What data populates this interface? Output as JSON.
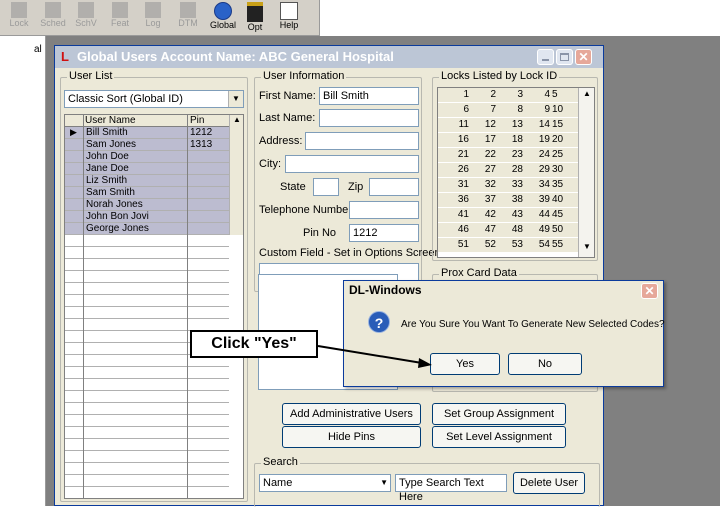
{
  "toolbar": {
    "buttons": [
      {
        "label": "Lock",
        "icon": "lock-icon",
        "enabled": false
      },
      {
        "label": "Sched",
        "icon": "schedule-icon",
        "enabled": false
      },
      {
        "label": "SchV",
        "icon": "schedule-view-icon",
        "enabled": false
      },
      {
        "label": "Feat",
        "icon": "feature-icon",
        "enabled": false
      },
      {
        "label": "Log",
        "icon": "log-icon",
        "enabled": false
      },
      {
        "label": "DTM",
        "icon": "dtm-icon",
        "enabled": false
      },
      {
        "label": "Global",
        "icon": "globe-icon",
        "enabled": true
      },
      {
        "label": "Opt",
        "icon": "options-icon",
        "enabled": true
      },
      {
        "label": "Help",
        "icon": "help-icon",
        "enabled": true
      }
    ],
    "side_label": "al"
  },
  "window": {
    "title": "Global Users Account Name: ABC General Hospital",
    "title_bg": "#bcc6d6"
  },
  "user_list": {
    "group_label": "User List",
    "sort_value": "Classic Sort (Global ID)",
    "columns": [
      "User Name",
      "Pin"
    ],
    "rows": [
      {
        "name": "Bill Smith",
        "pin": "1212"
      },
      {
        "name": "Sam Jones",
        "pin": "1313"
      },
      {
        "name": "John Doe",
        "pin": ""
      },
      {
        "name": "Jane Doe",
        "pin": ""
      },
      {
        "name": "Liz Smith",
        "pin": ""
      },
      {
        "name": "Sam Smith",
        "pin": ""
      },
      {
        "name": "Norah Jones",
        "pin": ""
      },
      {
        "name": "John Bon Jovi",
        "pin": ""
      },
      {
        "name": "George Jones",
        "pin": ""
      }
    ]
  },
  "user_info": {
    "group_label": "User Information",
    "first_name_label": "First Name:",
    "first_name_value": "Bill Smith",
    "last_name_label": "Last Name:",
    "last_name_value": "",
    "address_label": "Address:",
    "city_label": "City:",
    "state_label": "State",
    "zip_label": "Zip",
    "phone_label": "Telephone Number:",
    "pin_label": "Pin No",
    "pin_value": "1212",
    "custom_label": "Custom Field - Set in Options Screen"
  },
  "locks": {
    "group_label": "Locks Listed by Lock ID",
    "rows": [
      [
        "1",
        "2",
        "3",
        "4",
        "5"
      ],
      [
        "6",
        "7",
        "8",
        "9",
        "10"
      ],
      [
        "11",
        "12",
        "13",
        "14",
        "15"
      ],
      [
        "16",
        "17",
        "18",
        "19",
        "20"
      ],
      [
        "21",
        "22",
        "23",
        "24",
        "25"
      ],
      [
        "26",
        "27",
        "28",
        "29",
        "30"
      ],
      [
        "31",
        "32",
        "33",
        "34",
        "35"
      ],
      [
        "36",
        "37",
        "38",
        "39",
        "40"
      ],
      [
        "41",
        "42",
        "43",
        "44",
        "45"
      ],
      [
        "46",
        "47",
        "48",
        "49",
        "50"
      ],
      [
        "51",
        "52",
        "53",
        "54",
        "55"
      ]
    ]
  },
  "prox": {
    "group_label": "Prox Card Data"
  },
  "buttons": {
    "add_admin": "Add Administrative Users",
    "hide_pins": "Hide Pins",
    "set_group": "Set Group Assignment",
    "set_level": "Set Level Assignment"
  },
  "search": {
    "group_label": "Search",
    "field_value": "Name",
    "text_value": "Type Search Text Here",
    "delete_label": "Delete User"
  },
  "dialog": {
    "title": "DL-Windows",
    "message": "Are You Sure You Want To Generate New Selected Codes?",
    "yes_label": "Yes",
    "no_label": "No"
  },
  "callout": {
    "text": "Click \"Yes\""
  }
}
